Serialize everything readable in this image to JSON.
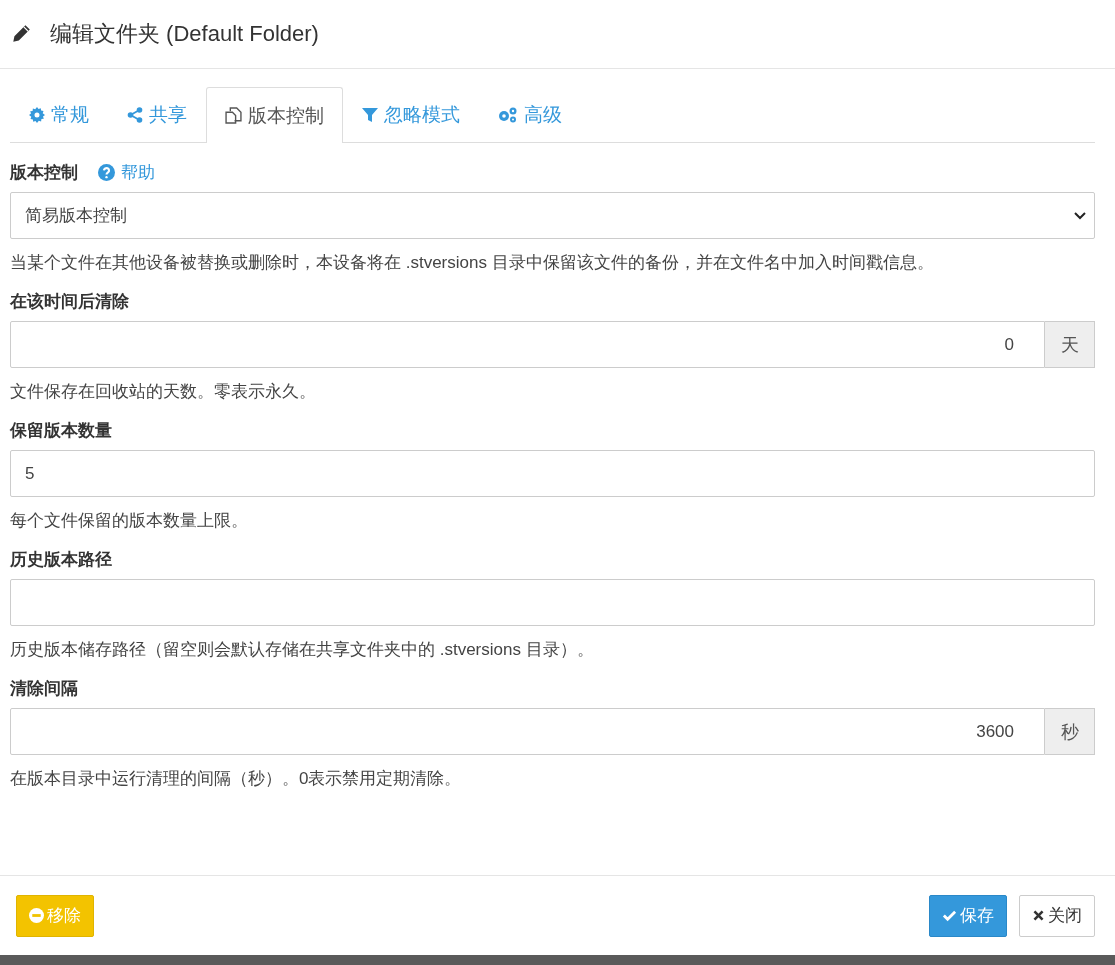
{
  "dialog": {
    "title": "编辑文件夹 (Default Folder)"
  },
  "tabs": [
    {
      "label": "常规",
      "selected": false
    },
    {
      "label": "共享",
      "selected": false
    },
    {
      "label": "版本控制",
      "selected": true
    },
    {
      "label": "忽略模式",
      "selected": false
    },
    {
      "label": "高级",
      "selected": false
    }
  ],
  "fields": [
    {
      "kind": "select",
      "label": "版本控制",
      "help": "帮助",
      "value": "简易版本控制",
      "description": "当某个文件在其他设备被替换或删除时，本设备将在 .stversions 目录中保留该文件的备份，并在文件名中加入时间戳信息。"
    },
    {
      "kind": "addon",
      "label": "在该时间后清除",
      "value": "0",
      "addon": "天",
      "description": "文件保存在回收站的天数。零表示永久。"
    },
    {
      "kind": "text",
      "label": "保留版本数量",
      "value": "5",
      "description": "每个文件保留的版本数量上限。"
    },
    {
      "kind": "text",
      "label": "历史版本路径",
      "description": "历史版本储存路径（留空则会默认存储在共享文件夹中的 .stversions 目录）。"
    },
    {
      "kind": "addon",
      "label": "清除间隔",
      "value": "3600",
      "addon": "秒",
      "description": "在版本目录中运行清理的间隔（秒）。0表示禁用定期清除。"
    }
  ],
  "footer": {
    "remove": "移除",
    "save": "保存",
    "close": "关闭"
  }
}
